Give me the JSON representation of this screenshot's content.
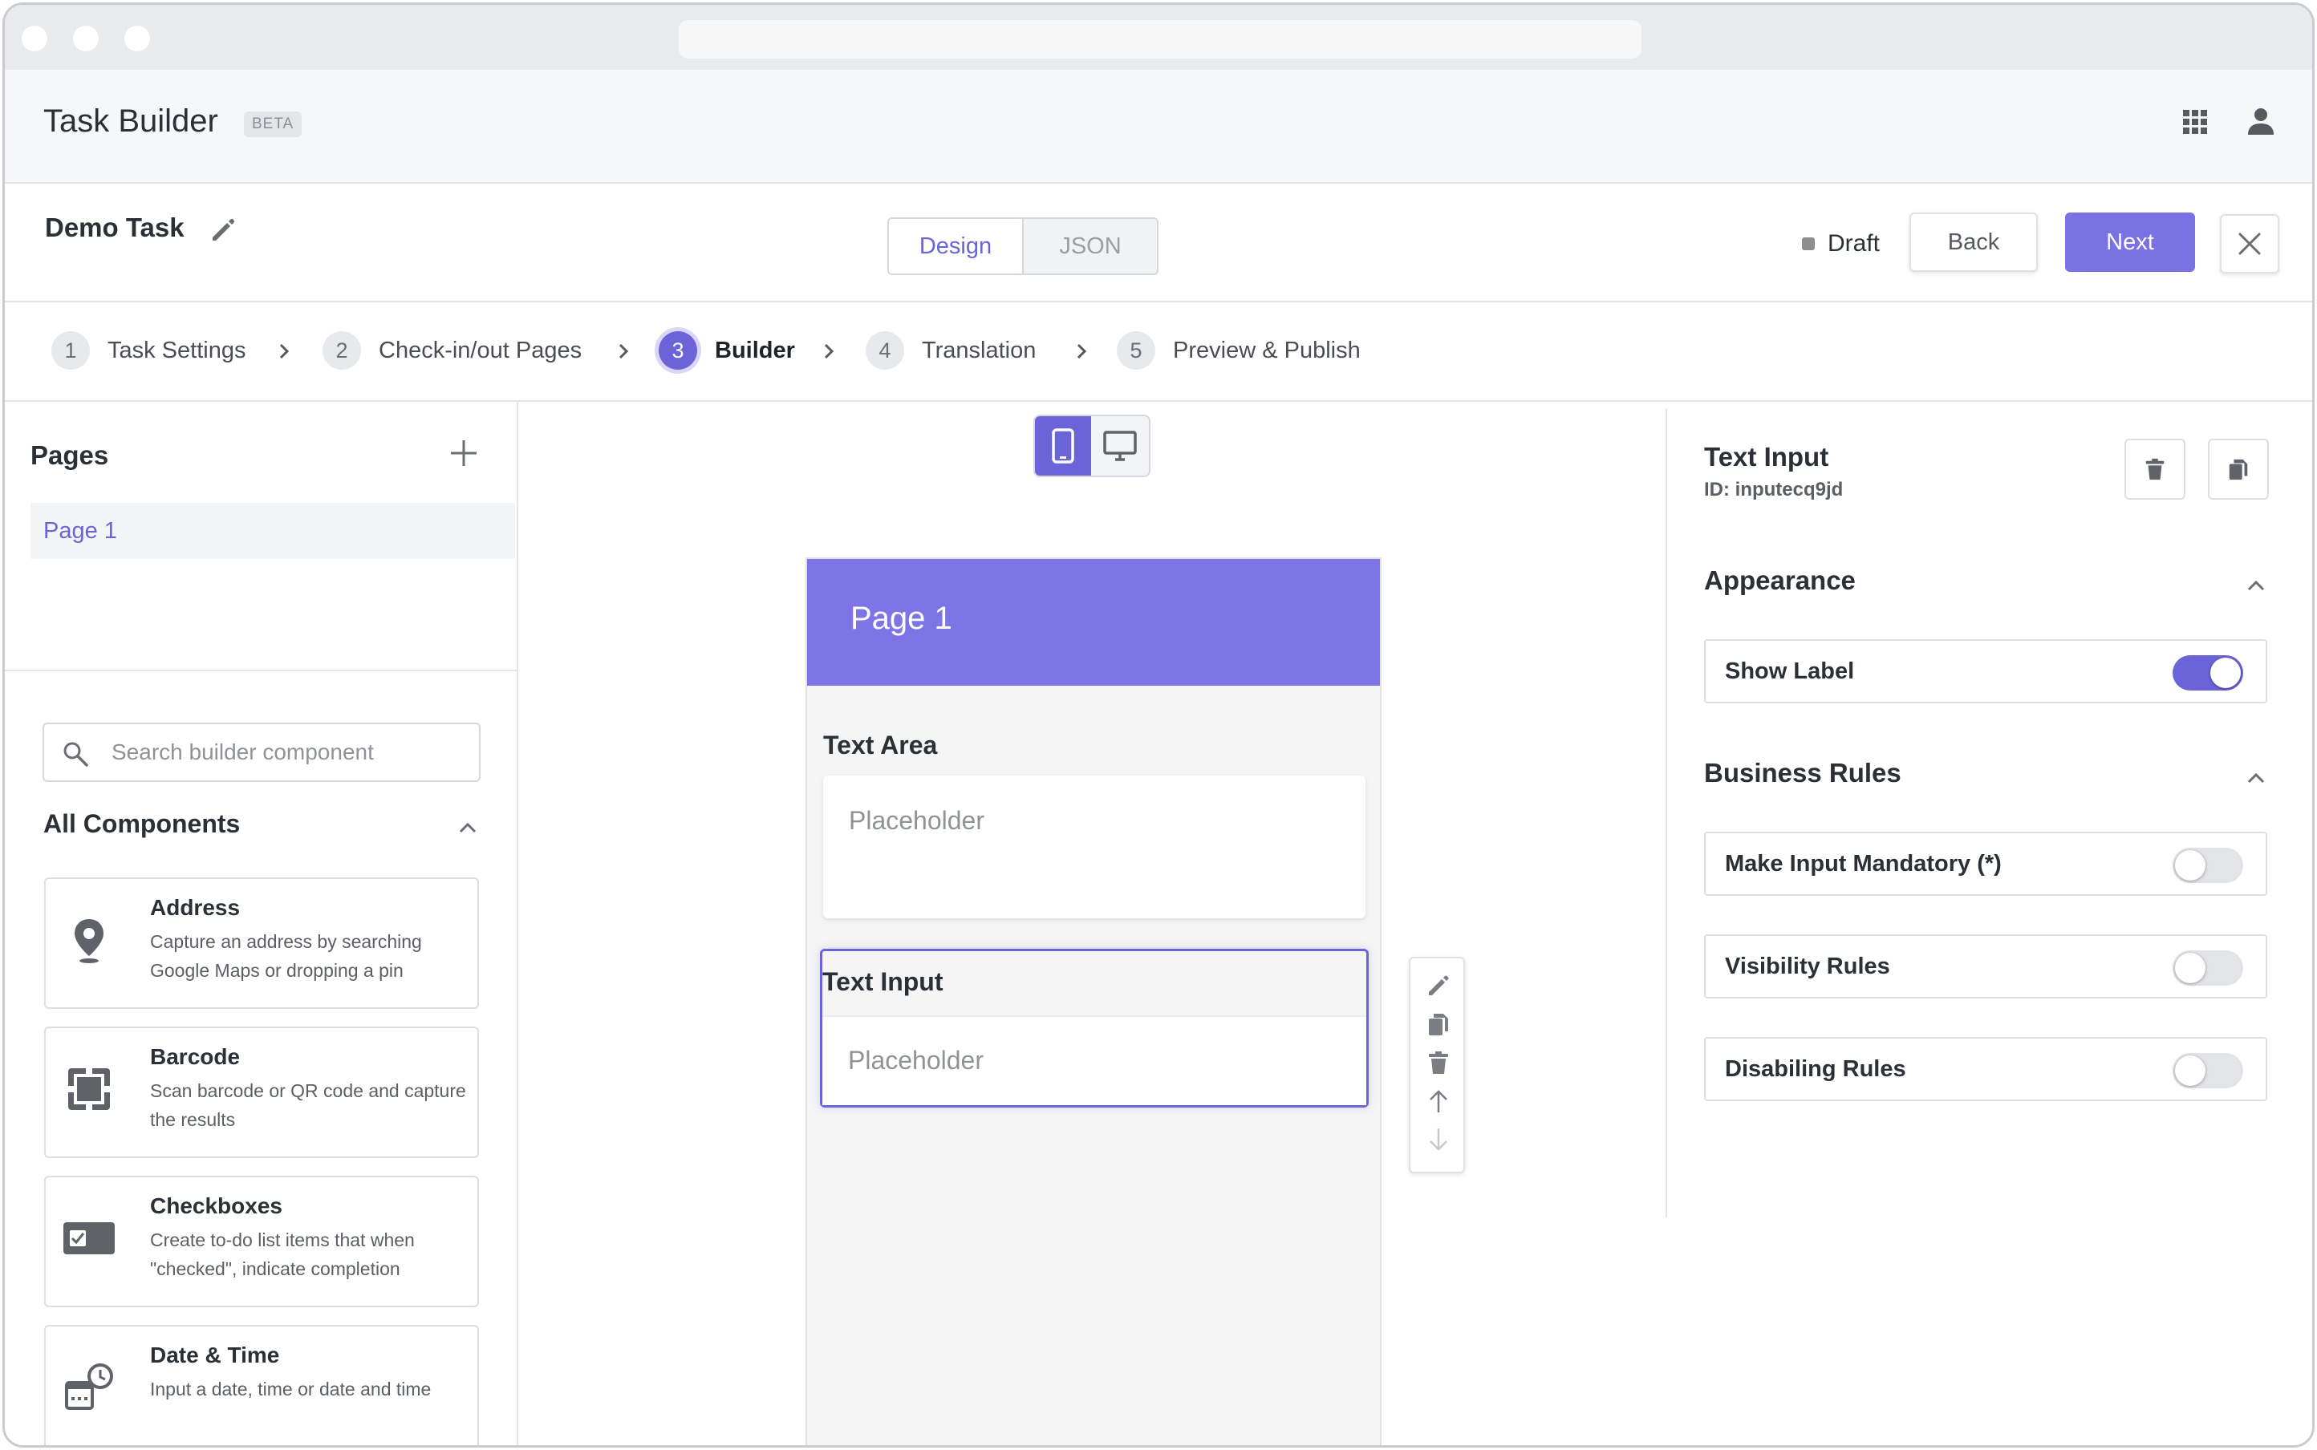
{
  "header": {
    "app_title": "Task Builder",
    "badge": "BETA",
    "apps_icon": "grid-icon",
    "user_icon": "user-icon"
  },
  "task": {
    "name": "Demo Task",
    "mode_tabs": [
      {
        "label": "Design",
        "active": true
      },
      {
        "label": "JSON",
        "active": false
      }
    ],
    "status": "Draft",
    "back_label": "Back",
    "next_label": "Next"
  },
  "stepper": [
    {
      "num": "1",
      "label": "Task Settings",
      "active": false
    },
    {
      "num": "2",
      "label": "Check-in/out Pages",
      "active": false
    },
    {
      "num": "3",
      "label": "Builder",
      "active": true
    },
    {
      "num": "4",
      "label": "Translation",
      "active": false
    },
    {
      "num": "5",
      "label": "Preview & Publish",
      "active": false
    }
  ],
  "sidebar": {
    "pages_title": "Pages",
    "pages": [
      "Page 1"
    ],
    "search_placeholder": "Search builder component",
    "components_title": "All Components",
    "components": [
      {
        "name": "Address",
        "desc": "Capture an address by searching Google Maps or dropping a pin",
        "icon": "map-pin-icon"
      },
      {
        "name": "Barcode",
        "desc": "Scan barcode or QR code and capture the results",
        "icon": "barcode-scan-icon"
      },
      {
        "name": "Checkboxes",
        "desc": "Create to-do list items that when \"checked\", indicate completion",
        "icon": "checkbox-icon"
      },
      {
        "name": "Date & Time",
        "desc": "Input a date, time or date and time",
        "icon": "calendar-clock-icon"
      }
    ]
  },
  "canvas": {
    "device_selected": "mobile",
    "page_title": "Page 1",
    "fields": [
      {
        "label": "Text Area",
        "placeholder": "Placeholder"
      },
      {
        "label": "Text Input",
        "placeholder": "Placeholder",
        "selected": true
      }
    ]
  },
  "properties": {
    "title": "Text Input",
    "id_text": "ID: inputecq9jd",
    "appearance_title": "Appearance",
    "appearance_options": [
      {
        "label": "Show Label",
        "on": true
      }
    ],
    "business_title": "Business Rules",
    "business_options": [
      {
        "label": "Make Input Mandatory (*)",
        "on": false
      },
      {
        "label": "Visibility Rules",
        "on": false
      },
      {
        "label": "Disabiling Rules",
        "on": false
      }
    ]
  },
  "colors": {
    "accent": "#6b63d8",
    "page_header": "#7d75e6",
    "next_button": "#7a71e4"
  }
}
